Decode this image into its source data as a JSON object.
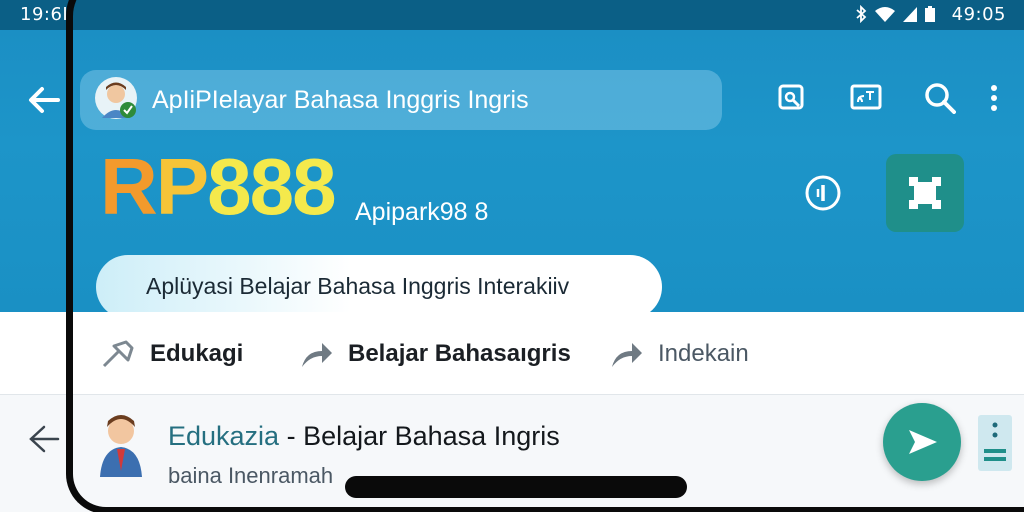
{
  "status_bar": {
    "time_left": "19:6I",
    "time_right": "49:05",
    "icons": [
      "bluetooth-icon",
      "wifi-icon",
      "signal-icon",
      "battery-icon"
    ]
  },
  "app_bar": {
    "title": "ApIiPIelayar Bahasa Inggris Ingris",
    "actions": [
      "search-document-icon",
      "cast-icon",
      "search-icon",
      "more-vert-icon"
    ]
  },
  "brand": {
    "logo_part1": "R",
    "logo_part2": "P",
    "logo_part3": "888",
    "subtitle": "Apipark98 8"
  },
  "description_pill": "Aplüyasi Belajar Bahasa Inggris Interakiiv",
  "tabs": [
    {
      "label": "Edukagi",
      "icon": "tool-icon"
    },
    {
      "label": "Belajar Bahasaıgris",
      "icon": "share-arrow-icon"
    },
    {
      "label": "Indekain",
      "icon": "share-arrow-icon"
    }
  ],
  "list_item": {
    "source": "Edukazia",
    "separator": " - ",
    "title": "Belajar Bahasa Ingris",
    "subtitle": "baina Inenramah"
  },
  "colors": {
    "status_bar": "#0b5f86",
    "app_bar": "#1d95c9",
    "accent_teal": "#2a9f8f",
    "logo_orange": "#f39a2c",
    "logo_yellow": "#f4e94c"
  }
}
